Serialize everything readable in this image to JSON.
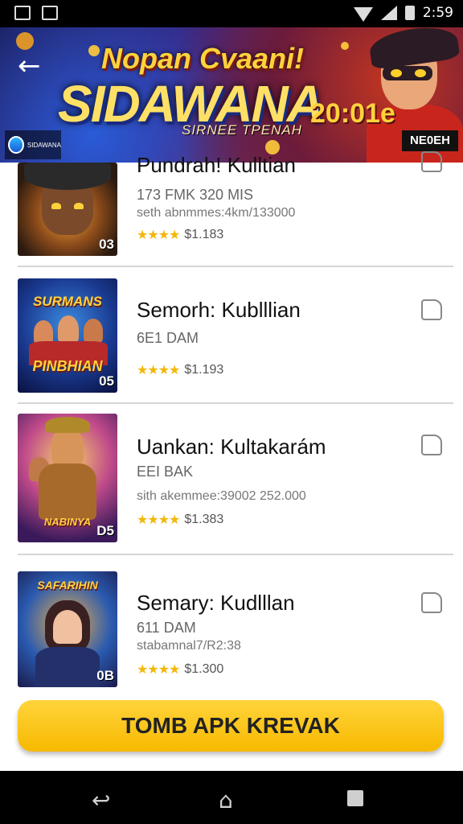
{
  "status_bar": {
    "time": "2:59"
  },
  "banner": {
    "back_icon": "arrow-left-icon",
    "title_line1": "Nopan Cvaani!",
    "title_line2": "SIDAWANA",
    "year_text": "20:01e",
    "subtitle": "SIRNEE TPENAH",
    "badge": "NE0EH",
    "logo_text": "SIDAWANA"
  },
  "games": [
    {
      "title": "Pundrah! Kulltian",
      "subtitle": "173 FMK 320 MIS",
      "stats": "seth abnmmes:4km/133000",
      "rating": "$1.183",
      "thumb_tag": "03",
      "thumb_title": ""
    },
    {
      "title": "Semorh: Kublllian",
      "subtitle": "6E1 DAM",
      "stats": "",
      "rating": "$1.193",
      "thumb_tag": "05",
      "thumb_title": "PINBHIAN"
    },
    {
      "title": "Uankan: Kultakarám",
      "subtitle": "EEI BAK",
      "stats": "sith akemmee:39002 252.000",
      "rating": "$1.383",
      "thumb_tag": "D5",
      "thumb_title": "NABINYA"
    },
    {
      "title": "Semary: Kudlllan",
      "subtitle": "611 DAM",
      "stats": "stabamnal7/R2:38",
      "rating": "$1.300",
      "thumb_tag": "0B",
      "thumb_title": "SAFARIHIN"
    }
  ],
  "cta": {
    "label": "TOMB APK KREVAK"
  },
  "nav_bar": {
    "back": "back-icon",
    "home": "home-icon",
    "recents": "recents-icon"
  },
  "colors": {
    "accent": "#f7b900",
    "star": "#f2b70a"
  }
}
